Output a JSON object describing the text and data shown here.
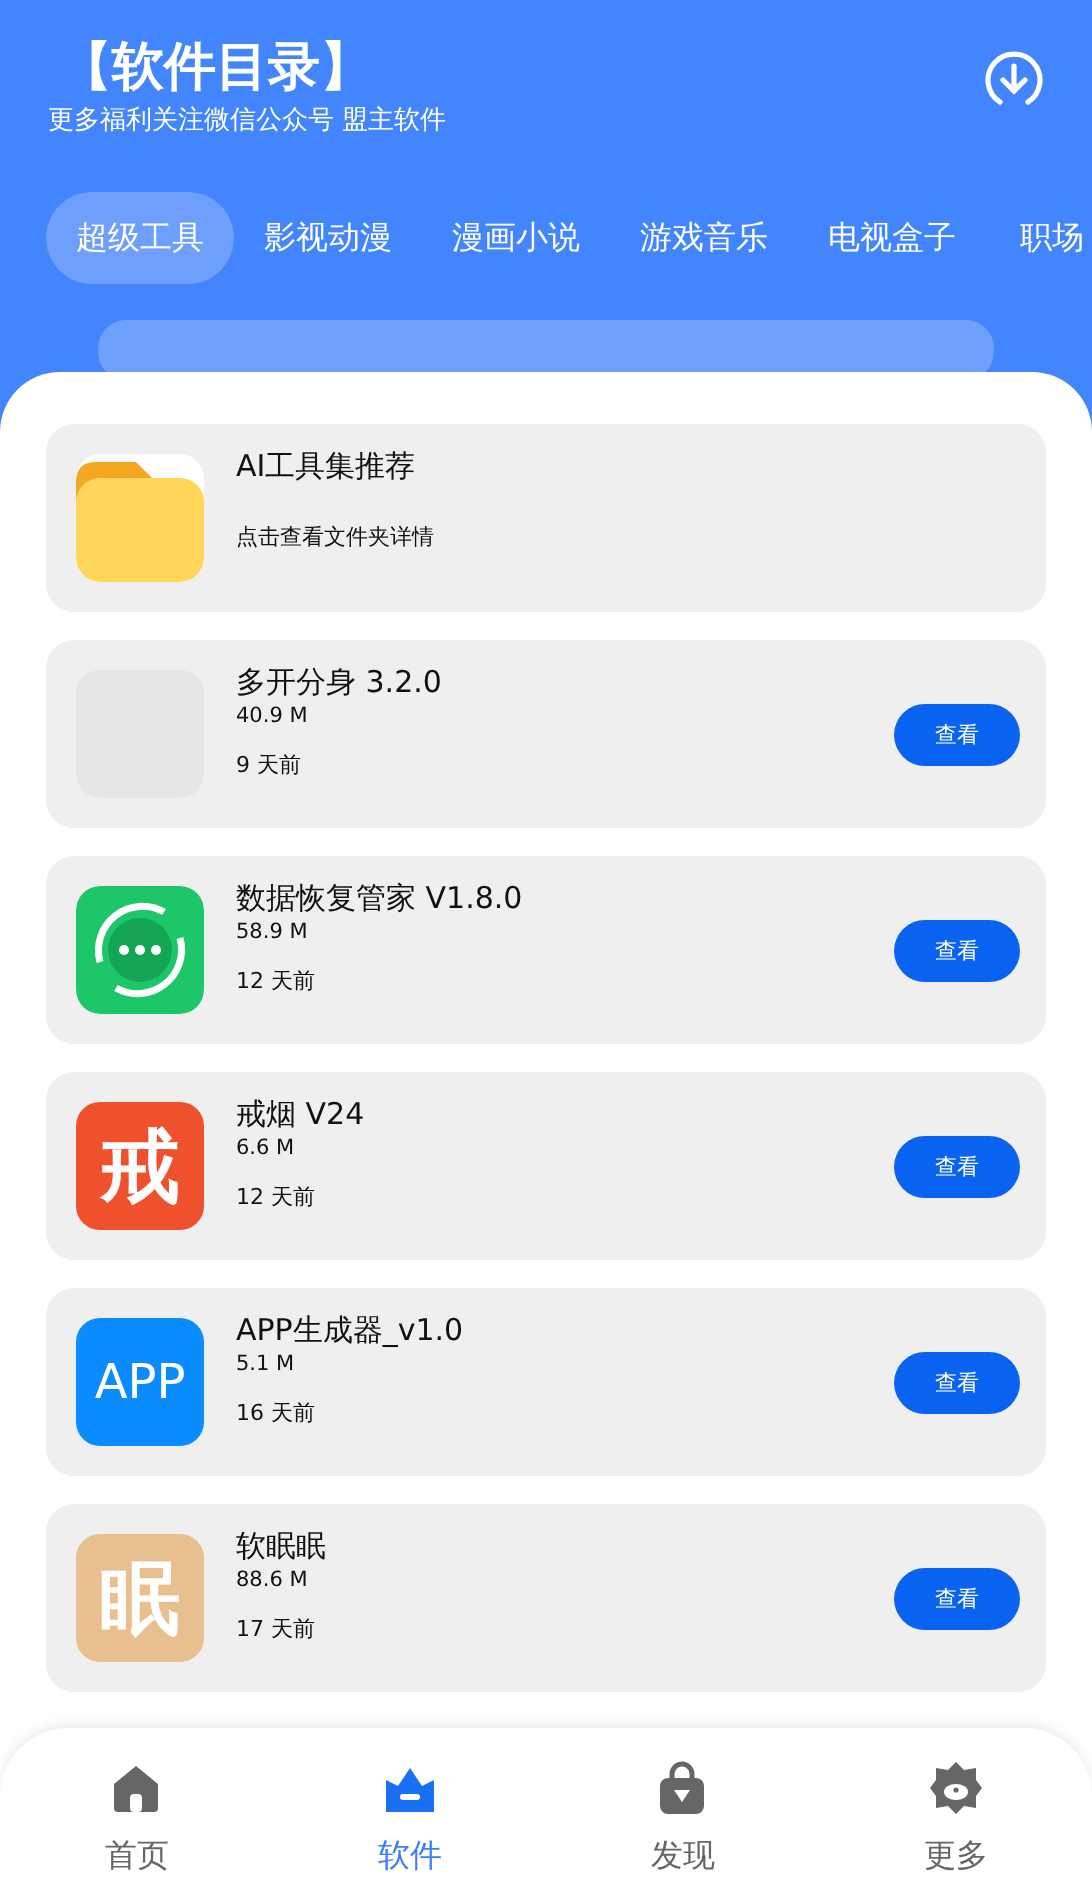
{
  "header": {
    "title": "【软件目录】",
    "subtitle": "更多福利关注微信公众号 盟主软件"
  },
  "tabs": [
    {
      "label": "超级工具",
      "selected": true
    },
    {
      "label": "影视动漫",
      "selected": false
    },
    {
      "label": "漫画小说",
      "selected": false
    },
    {
      "label": "游戏音乐",
      "selected": false
    },
    {
      "label": "电视盒子",
      "selected": false
    },
    {
      "label": "职场",
      "selected": false
    }
  ],
  "items": [
    {
      "kind": "folder",
      "icon": {
        "kind": "folder"
      },
      "name": "AI工具集推荐",
      "note": "点击查看文件夹详情"
    },
    {
      "kind": "app",
      "icon": {
        "kind": "blank"
      },
      "name": "多开分身 3.2.0",
      "size": "40.9 M",
      "time": "9 天前",
      "button": "查看"
    },
    {
      "kind": "app",
      "icon": {
        "kind": "chat"
      },
      "name": "数据恢复管家 V1.8.0",
      "size": "58.9 M",
      "time": "12 天前",
      "button": "查看"
    },
    {
      "kind": "app",
      "icon": {
        "kind": "glyph",
        "text": "戒",
        "color": "#f0512d"
      },
      "name": "戒烟 V24",
      "size": "6.6 M",
      "time": "12 天前",
      "button": "查看"
    },
    {
      "kind": "app",
      "icon": {
        "kind": "glyph",
        "text": "APP",
        "color": "#0a8cff"
      },
      "name": "APP生成器_v1.0",
      "size": "5.1 M",
      "time": "16 天前",
      "button": "查看"
    },
    {
      "kind": "app",
      "icon": {
        "kind": "glyph",
        "text": "眠",
        "color": "#e8c090"
      },
      "name": "软眠眠",
      "size": "88.6 M",
      "time": "17 天前",
      "button": "查看"
    }
  ],
  "nav": [
    {
      "label": "首页",
      "kind": "home",
      "selected": false
    },
    {
      "label": "软件",
      "kind": "crown",
      "selected": true
    },
    {
      "label": "发现",
      "kind": "bag",
      "selected": false
    },
    {
      "label": "更多",
      "kind": "flower",
      "selected": false
    }
  ]
}
